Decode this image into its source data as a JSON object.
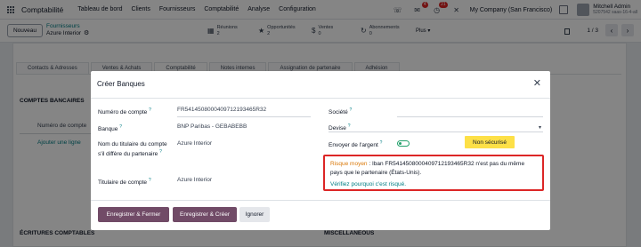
{
  "navbar": {
    "app_name": "Comptabilité",
    "menu": [
      "Tableau de bord",
      "Clients",
      "Fournisseurs",
      "Comptabilité",
      "Analyse",
      "Configuration"
    ],
    "messages_count": "4",
    "activities_count": "21",
    "company": "My Company (San Francisco)",
    "user_name": "Mitchell Admin",
    "user_db": "5207542 saas-16-4-all"
  },
  "control_panel": {
    "new_button": "Nouveau",
    "breadcrumb_parent": "Fournisseurs",
    "breadcrumb_current": "Azure Interior",
    "stats": [
      {
        "label": "Réunions",
        "value": "2"
      },
      {
        "label": "Opportunités",
        "value": "2"
      },
      {
        "label": "Ventes",
        "value": "0"
      },
      {
        "label": "Abonnements",
        "value": "0"
      }
    ],
    "more_label": "Plus",
    "pager": "1 / 3"
  },
  "background_form": {
    "tabs": [
      "Contacts & Adresses",
      "Ventes & Achats",
      "Comptabilité",
      "Notes internes",
      "Assignation de partenaire",
      "Adhésion"
    ],
    "bank_section": "COMPTES BANCAIRES",
    "account_number_label": "Numéro de compte",
    "add_line": "Ajouter une ligne",
    "entries_section": "ÉCRITURES COMPTABLES",
    "misc_section": "MISCELLANEOUS"
  },
  "modal": {
    "title": "Créer Banques",
    "fields": {
      "account_number_label": "Numéro de compte",
      "account_number_value": "FR5414508000409712193465R32",
      "bank_label": "Banque",
      "bank_value": "BNP Paribas - GEBABEBB",
      "holder_name_label": "Nom du titulaire du compte s'il diffère du partenaire",
      "holder_name_value": "Azure Interior",
      "holder_label": "Titulaire de compte",
      "holder_value": "Azure Interior",
      "company_label": "Société",
      "currency_label": "Devise",
      "send_money_label": "Envoyer de l'argent",
      "unsecured_badge": "Non sécurisé"
    },
    "warning": {
      "risk": "Risque moyen",
      "message": " : Iban FR5414508000409712193465R32 n'est pas du même pays que le partenaire (États-Unis).",
      "link": "Vérifiez pourquoi c'est risqué."
    },
    "buttons": {
      "save_close": "Enregistrer & Fermer",
      "save_new": "Enregistrer & Créer",
      "discard": "Ignorer"
    }
  },
  "colors": {
    "primary": "#714b67",
    "link": "#017e84",
    "warning_border": "#dc2626",
    "badge_yellow": "#fde047",
    "risk_orange": "#d97706"
  }
}
